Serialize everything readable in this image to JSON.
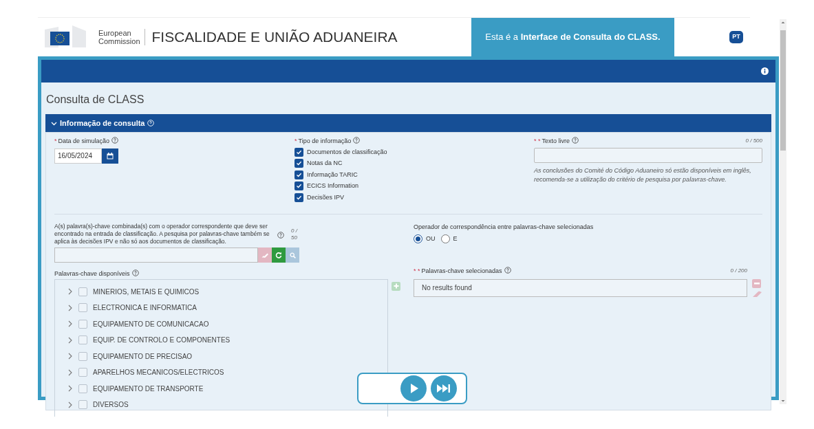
{
  "header": {
    "logo_text": [
      "European",
      "Commission"
    ],
    "title": "FISCALIDADE E UNIÃO ADUANEIRA",
    "banner": "Esta é a **Interface de Consulta do CLASS.**",
    "language": "PT"
  },
  "page_title": "Consulta de CLASS",
  "section": {
    "title": "Informação de consulta",
    "expanded": true
  },
  "date": {
    "marker": "*",
    "label": "Data de simulação",
    "value": "16/05/2024"
  },
  "info_type": {
    "marker": "*",
    "label": "Tipo de informação",
    "options": [
      {
        "label": "Documentos de classificação",
        "checked": true
      },
      {
        "label": "Notas da NC",
        "checked": true
      },
      {
        "label": "Informação TARIC",
        "checked": true
      },
      {
        "label": "ECICS Information",
        "checked": true
      },
      {
        "label": "Decisões IPV",
        "checked": true
      }
    ]
  },
  "free_text": {
    "marker": "* *",
    "label": "Texto livre",
    "counter": "0 / 500",
    "note": "As conclusões do Comité do Código Aduaneiro só estão disponíveis em inglês, recomenda-se a utilização do critério de pesquisa por palavras-chave."
  },
  "keywords": {
    "description": "A(s) palavra(s)-chave combinada(s) com o operador correspondente que deve ser encontrado na entrada de classificação. A pesquisa por palavras-chave também se aplica às decisões IPV e não só aos documentos de classificação.",
    "counter": "0 / 50"
  },
  "operator": {
    "label": "Operador de correspondência entre palavras-chave selecionadas",
    "options": [
      {
        "label": "OU",
        "selected": true
      },
      {
        "label": "E",
        "selected": false
      }
    ]
  },
  "available": {
    "label": "Palavras-chave disponíveis",
    "items": [
      {
        "label": "MINERIOS, METAIS E QUIMICOS",
        "checked": false,
        "expanded": false
      },
      {
        "label": "ELECTRONICA E INFORMATICA",
        "checked": false,
        "expanded": false
      },
      {
        "label": "EQUIPAMENTO DE COMUNICACAO",
        "checked": false,
        "expanded": false
      },
      {
        "label": "EQUIP. DE CONTROLO E COMPONENTES",
        "checked": false,
        "expanded": false
      },
      {
        "label": "EQUIPAMENTO DE PRECISAO",
        "checked": false,
        "expanded": false
      },
      {
        "label": "APARELHOS MECANICOS/ELECTRICOS",
        "checked": false,
        "expanded": false
      },
      {
        "label": "EQUIPAMENTO DE TRANSPORTE",
        "checked": false,
        "expanded": false
      },
      {
        "label": "DIVERSOS",
        "checked": false,
        "expanded": false
      }
    ]
  },
  "selected": {
    "marker": "* *",
    "label": "Palavras-chave selecionadas",
    "counter": "0 / 200",
    "empty_text": "No results found"
  }
}
